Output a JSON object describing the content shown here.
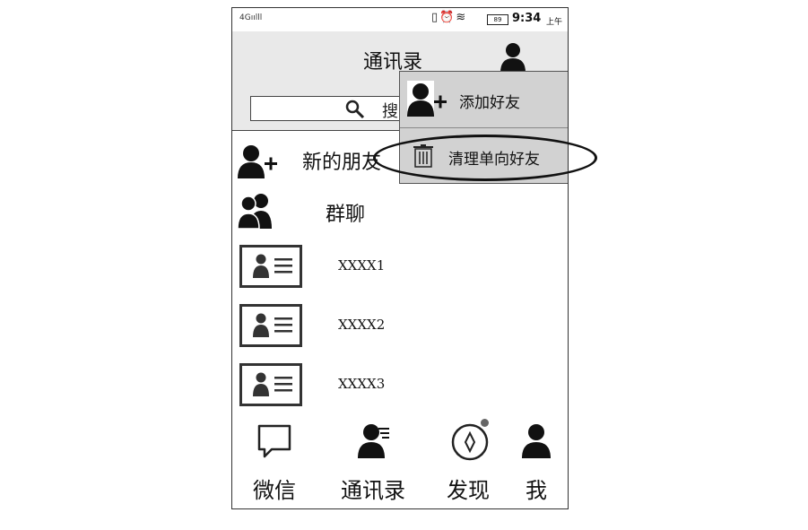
{
  "status_bar": {
    "network": "4G",
    "battery": "89",
    "time": "9:34",
    "ampm": "上午"
  },
  "header": {
    "title": "通讯录",
    "search_placeholder": "搜"
  },
  "list": {
    "new_friends": "新的朋友",
    "group_chat": "群聊",
    "contacts": [
      "XXXX1",
      "XXXX2",
      "XXXX3"
    ]
  },
  "popup_menu": {
    "items": [
      "添加好友",
      "清理单向好友"
    ]
  },
  "tabbar": {
    "tabs": [
      "微信",
      "通讯录",
      "发现",
      "我"
    ]
  },
  "icons": [
    "signal-icon",
    "vibrate-icon",
    "alarm-icon",
    "wifi-icon",
    "battery-icon",
    "avatar-icon",
    "search-icon",
    "add-friend-icon",
    "trash-icon",
    "group-icon",
    "contact-card-icon",
    "chat-icon",
    "contacts-icon",
    "compass-icon",
    "me-icon"
  ]
}
